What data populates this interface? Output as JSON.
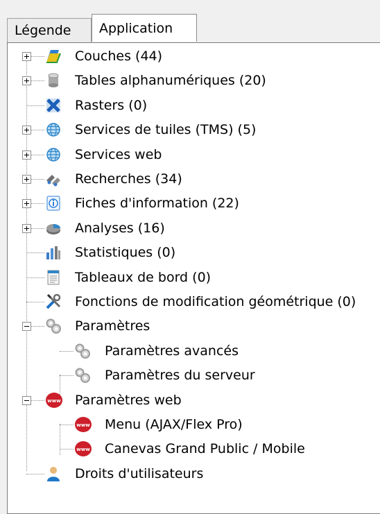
{
  "tabs": [
    {
      "label": "Légende",
      "active": false
    },
    {
      "label": "Application",
      "active": true
    }
  ],
  "tree": {
    "items": [
      {
        "label": "Couches (44)",
        "icon": "layers-icon",
        "expander": "plus"
      },
      {
        "label": "Tables alphanumériques (20)",
        "icon": "database-icon",
        "expander": "plus"
      },
      {
        "label": "Rasters (0)",
        "icon": "raster-icon",
        "expander": "none"
      },
      {
        "label": "Services de tuiles (TMS) (5)",
        "icon": "globe-icon",
        "expander": "plus"
      },
      {
        "label": "Services web",
        "icon": "globe-icon",
        "expander": "plus"
      },
      {
        "label": "Recherches (34)",
        "icon": "binoculars-icon",
        "expander": "plus"
      },
      {
        "label": "Fiches d'information (22)",
        "icon": "info-icon",
        "expander": "plus"
      },
      {
        "label": "Analyses (16)",
        "icon": "pie-chart-icon",
        "expander": "plus"
      },
      {
        "label": "Statistiques (0)",
        "icon": "bar-chart-icon",
        "expander": "none"
      },
      {
        "label": "Tableaux de bord (0)",
        "icon": "dashboard-icon",
        "expander": "none"
      },
      {
        "label": "Fonctions de modification géométrique (0)",
        "icon": "tools-icon",
        "expander": "none"
      },
      {
        "label": "Paramètres",
        "icon": "gears-icon",
        "expander": "minus"
      },
      {
        "label": "Paramètres avancés",
        "icon": "gears-icon",
        "expander": "child"
      },
      {
        "label": "Paramètres du serveur",
        "icon": "gears-icon",
        "expander": "child"
      },
      {
        "label": "Paramètres web",
        "icon": "www-icon",
        "expander": "minus"
      },
      {
        "label": "Menu (AJAX/Flex Pro)",
        "icon": "www-icon",
        "expander": "child"
      },
      {
        "label": "Canevas Grand Public / Mobile",
        "icon": "www-icon",
        "expander": "child"
      },
      {
        "label": "Droits d'utilisateurs",
        "icon": "user-icon",
        "expander": "none"
      }
    ]
  },
  "colors": {
    "panel_background": "#ffffff",
    "window_background": "#f0f0f0",
    "www_red": "#cc1f2a",
    "globe_blue": "#2f86c8"
  }
}
